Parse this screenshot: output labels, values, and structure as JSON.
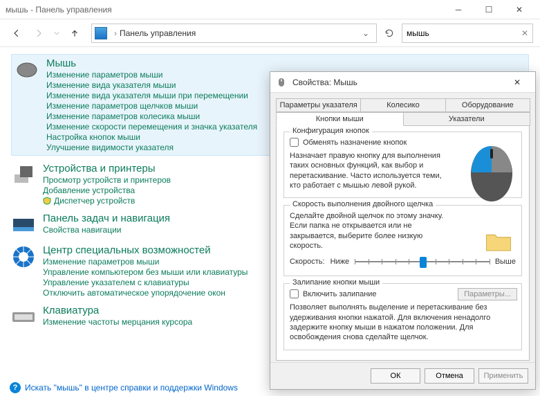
{
  "titlebar": {
    "text": "мышь - Панель управления"
  },
  "nav": {
    "path": "Панель управления",
    "search_value": "мышь"
  },
  "groups": [
    {
      "icon": "mouse",
      "title": "Мышь",
      "highlight": true,
      "links": [
        "Изменение параметров мыши",
        "Изменение вида указателя мыши",
        "Изменение вида указателя мыши при перемещении",
        "Изменение параметров щелчков мыши",
        "Изменение параметров колесика мыши",
        "Изменение скорости перемещения и значка указателя",
        "Настройка кнопок мыши",
        "Улучшение видимости указателя"
      ]
    },
    {
      "icon": "devices",
      "title": "Устройства и принтеры",
      "links": [
        "Просмотр устройств и принтеров",
        "Добавление устройства",
        {
          "text": "Диспетчер устройств",
          "shield": true
        }
      ]
    },
    {
      "icon": "taskbar",
      "title": "Панель задач и навигация",
      "links": [
        "Свойства навигации"
      ]
    },
    {
      "icon": "ease",
      "title": "Центр специальных возможностей",
      "links": [
        "Изменение параметров мыши",
        "Управление компьютером без мыши или клавиатуры",
        "Управление указателем с клавиатуры",
        "Отключить автоматическое упорядочение окон"
      ]
    },
    {
      "icon": "keyboard",
      "title": "Клавиатура",
      "links": [
        "Изменение частоты мерцания курсора"
      ]
    }
  ],
  "help": "Искать \"мышь\" в центре справки и поддержки Windows",
  "dialog": {
    "title": "Свойства: Мышь",
    "tabs_row1": [
      "Параметры указателя",
      "Колесико",
      "Оборудование"
    ],
    "tabs_row2": [
      "Кнопки мыши",
      "Указатели"
    ],
    "active_tab": "Кнопки мыши",
    "group1": {
      "legend": "Конфигурация кнопок",
      "checkbox": "Обменять назначение кнопок",
      "desc": "Назначает правую кнопку для выполнения таких основных функций, как выбор и перетаскивание. Часто используется теми, кто работает с мышью левой рукой."
    },
    "group2": {
      "legend": "Скорость выполнения двойного щелчка",
      "desc": "Сделайте двойной щелчок по этому значку. Если папка не открывается или не закрывается, выберите более низкую скорость.",
      "speed_label": "Скорость:",
      "slow": "Ниже",
      "fast": "Выше"
    },
    "group3": {
      "legend": "Залипание кнопки мыши",
      "checkbox": "Включить залипание",
      "settings_btn": "Параметры...",
      "desc": "Позволяет выполнять выделение и перетаскивание без удерживания кнопки нажатой. Для включения ненадолго задержите кнопку мыши в нажатом положении. Для освобождения снова сделайте щелчок."
    },
    "buttons": {
      "ok": "ОК",
      "cancel": "Отмена",
      "apply": "Применить"
    }
  }
}
